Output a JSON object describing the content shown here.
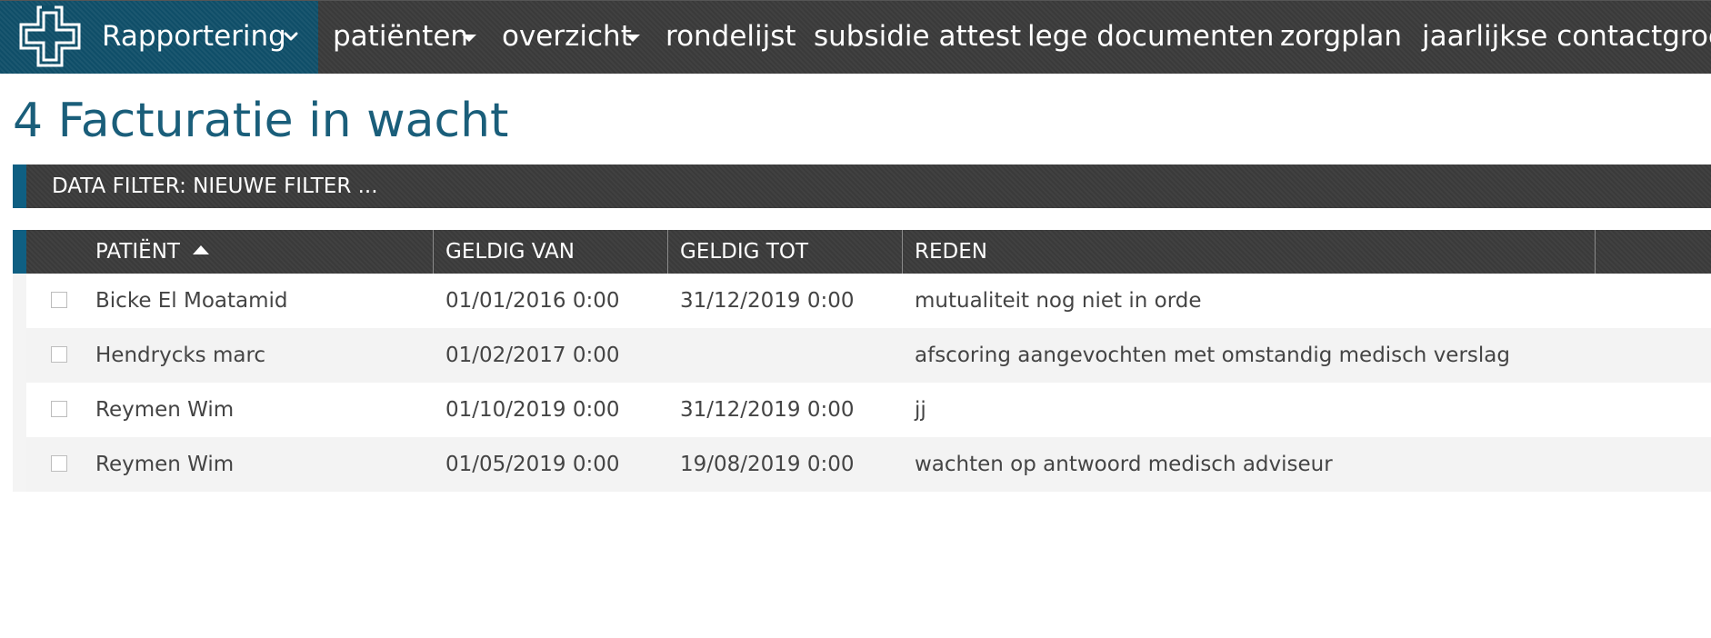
{
  "nav": {
    "brand_label": "Rapportering",
    "items": [
      {
        "label": "patiënten",
        "has_dropdown": true
      },
      {
        "label": "overzicht",
        "has_dropdown": true
      },
      {
        "label": "rondelijst",
        "has_dropdown": false
      },
      {
        "label": "subsidie attest",
        "has_dropdown": false
      },
      {
        "label": "lege documenten",
        "has_dropdown": false
      },
      {
        "label": "zorgplan",
        "has_dropdown": false
      },
      {
        "label": "jaarlijkse contactgroep",
        "has_dropdown": false
      }
    ]
  },
  "page": {
    "title": "4 Facturatie in wacht"
  },
  "filter": {
    "label": "DATA FILTER: NIEUWE FILTER ..."
  },
  "table": {
    "columns": [
      "PATIËNT",
      "GELDIG VAN",
      "GELDIG TOT",
      "REDEN"
    ],
    "sort_column": "PATIËNT",
    "sort_direction": "ascending",
    "rows": [
      {
        "patient": "Bicke El Moatamid",
        "geldig_van": "01/01/2016 0:00",
        "geldig_tot": "31/12/2019 0:00",
        "reden": "mutualiteit nog niet in orde"
      },
      {
        "patient": "Hendrycks marc",
        "geldig_van": "01/02/2017 0:00",
        "geldig_tot": "",
        "reden": "afscoring aangevochten met omstandig medisch verslag"
      },
      {
        "patient": "Reymen Wim",
        "geldig_van": "01/10/2019 0:00",
        "geldig_tot": "31/12/2019 0:00",
        "reden": "jj"
      },
      {
        "patient": "Reymen Wim",
        "geldig_van": "01/05/2019 0:00",
        "geldig_tot": "19/08/2019 0:00",
        "reden": "wachten op antwoord medisch adviseur"
      }
    ]
  },
  "colors": {
    "brand_blue": "#0f4e68",
    "accent_blue": "#0f5f82",
    "title_blue": "#1a5e7a",
    "dark_bar": "#3a3a3a",
    "row_alt": "#f3f3f3"
  }
}
